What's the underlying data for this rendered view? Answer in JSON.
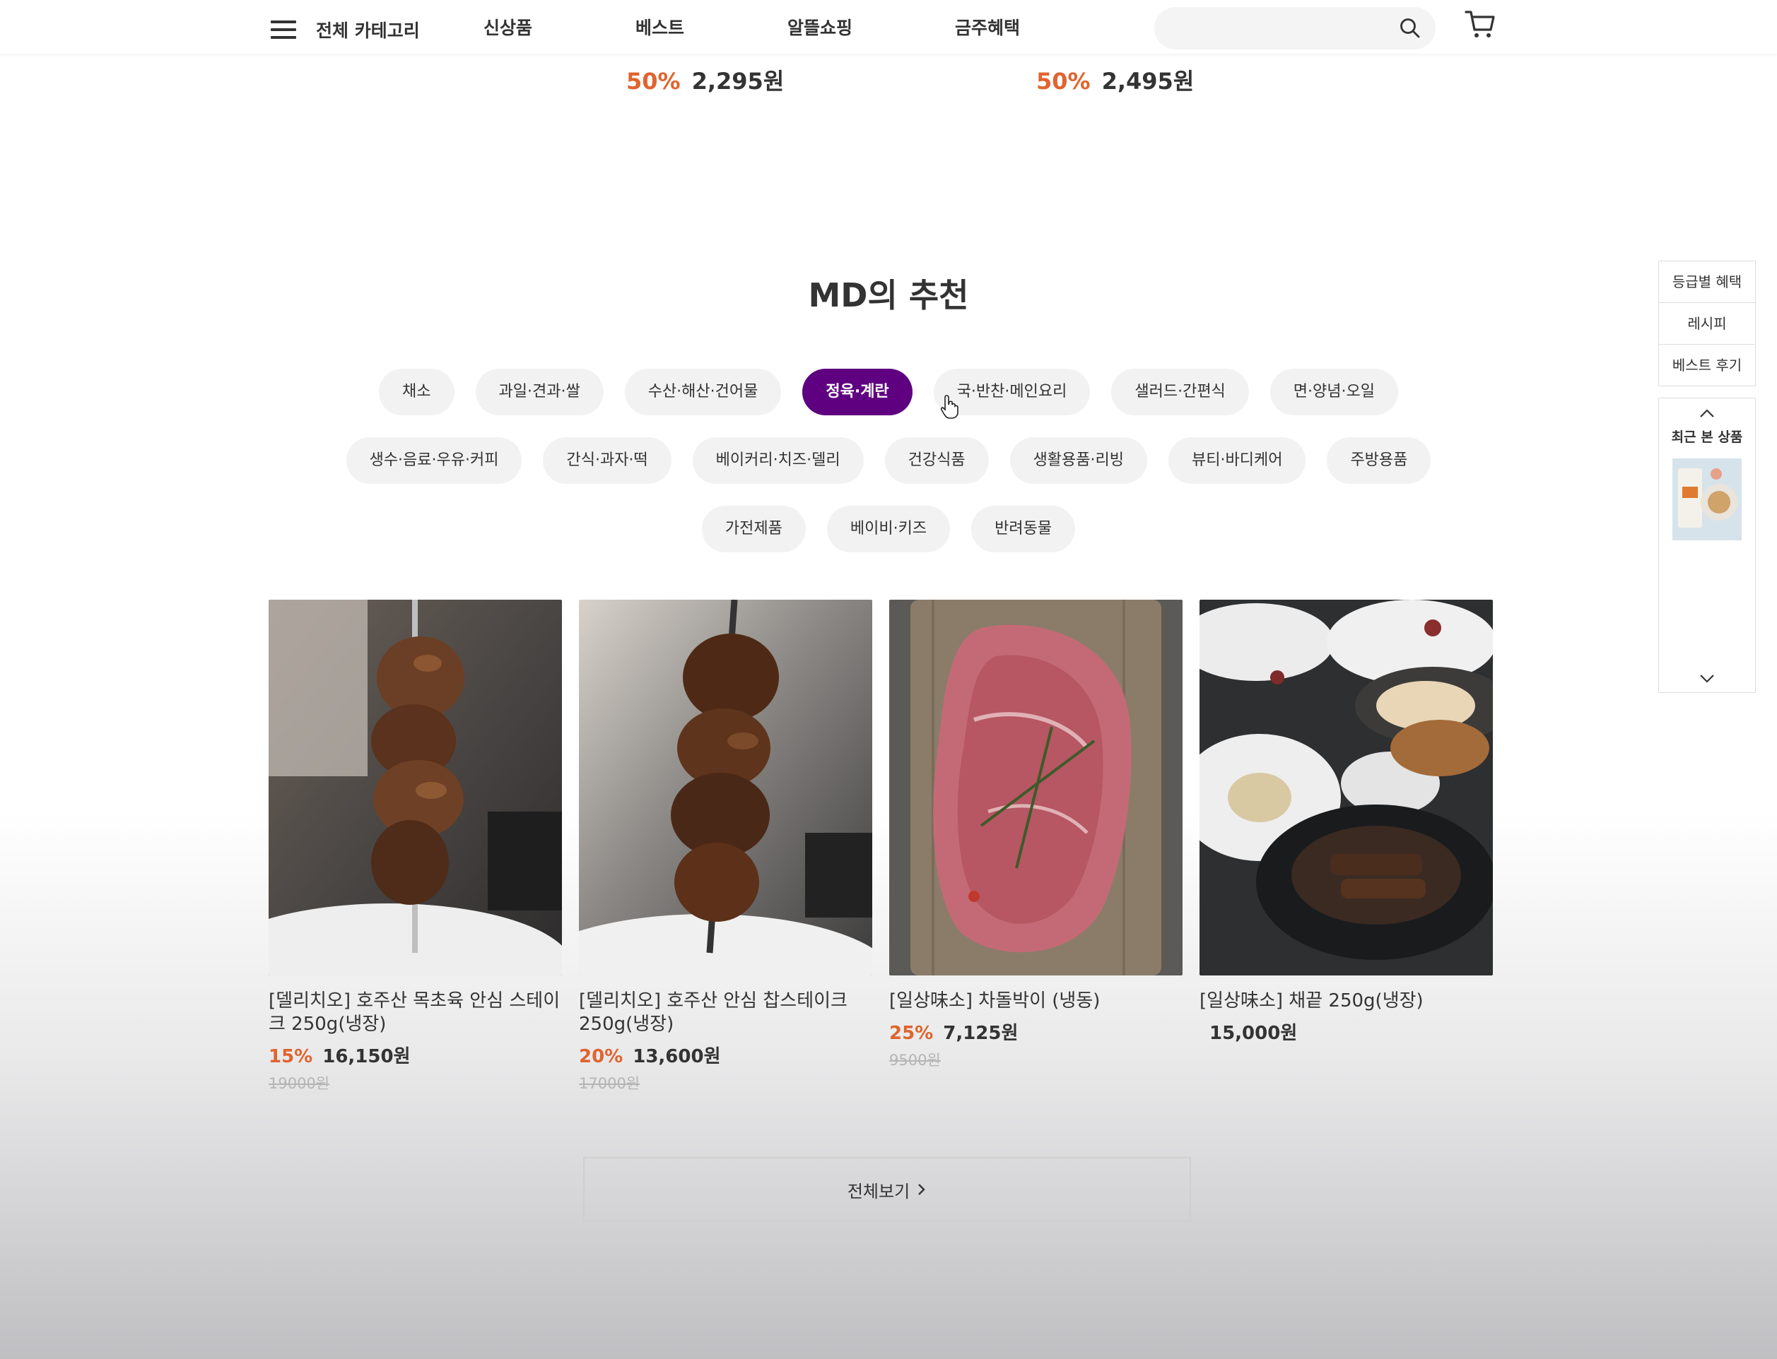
{
  "header": {
    "menu_label": "전체 카테고리",
    "nav": [
      "신상품",
      "베스트",
      "알뜰쇼핑",
      "금주혜택"
    ],
    "search_placeholder": ""
  },
  "top_prices": [
    {
      "rate": "50%",
      "price": "2,295원"
    },
    {
      "rate": "50%",
      "price": "2,495원"
    }
  ],
  "section": {
    "title": "MD의 추천",
    "categories_row1": [
      "채소",
      "과일·견과·쌀",
      "수산·해산·건어물",
      "정육·계란",
      "국·반찬·메인요리",
      "샐러드·간편식",
      "면·양념·오일"
    ],
    "categories_row2": [
      "생수·음료·우유·커피",
      "간식·과자·떡",
      "베이커리·치즈·델리",
      "건강식품",
      "생활용품·리빙",
      "뷰티·바디케어",
      "주방용품"
    ],
    "categories_row3": [
      "가전제품",
      "베이비·키즈",
      "반려동물"
    ],
    "active_category": "정육·계란"
  },
  "products": [
    {
      "name": "[델리치오] 호주산 목초육 안심 스테이크 250g(냉장)",
      "rate": "15%",
      "price": "16,150원",
      "original": "19000원"
    },
    {
      "name": "[델리치오] 호주산 안심 찹스테이크 250g(냉장)",
      "rate": "20%",
      "price": "13,600원",
      "original": "17000원"
    },
    {
      "name": "[일상味소] 차돌박이 (냉동)",
      "rate": "25%",
      "price": "7,125원",
      "original": "9500원"
    },
    {
      "name": "[일상味소] 채끝 250g(냉장)",
      "rate": "",
      "price": "15,000원",
      "original": ""
    }
  ],
  "view_all": {
    "label": "전체보기"
  },
  "side_menu": {
    "links": [
      "등급별 혜택",
      "레시피",
      "베스트 후기"
    ],
    "recent_title": "최근 본 상품"
  },
  "colors": {
    "brand_purple": "#5f0080",
    "discount_orange": "#e0642f"
  },
  "icons": [
    "hamburger-icon",
    "search-icon",
    "cart-icon",
    "chevron-right-icon",
    "chevron-up-icon",
    "chevron-down-icon",
    "hand-cursor-icon"
  ]
}
